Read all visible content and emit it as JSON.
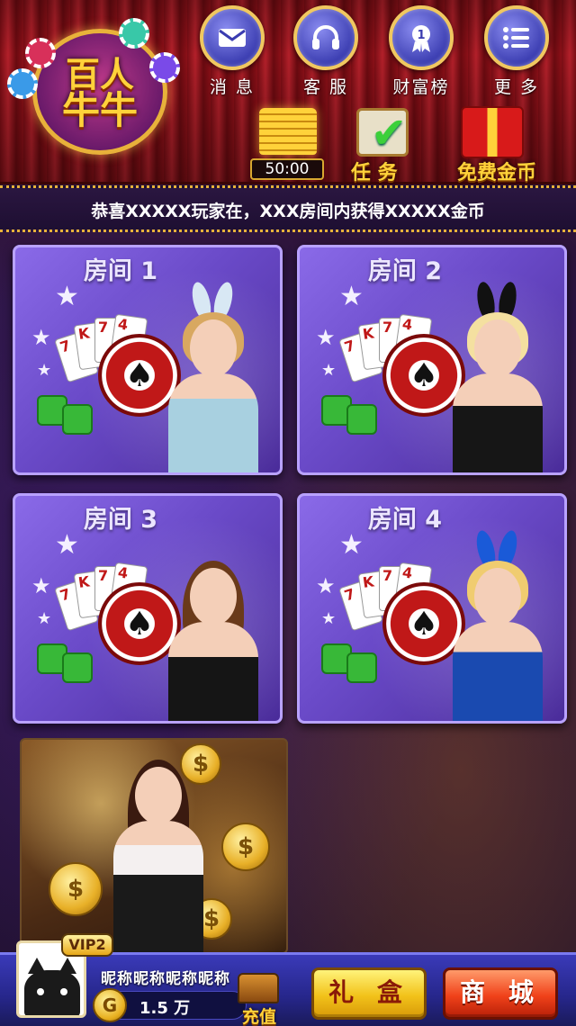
{
  "logo": {
    "line1": "百人",
    "line2": "牛牛"
  },
  "nav": [
    {
      "label": "消 息",
      "icon": "mail-icon"
    },
    {
      "label": "客 服",
      "icon": "headset-icon"
    },
    {
      "label": "财富榜",
      "icon": "medal-icon"
    },
    {
      "label": "更 多",
      "icon": "menu-list-icon"
    }
  ],
  "actions": {
    "timer": "50:00",
    "task_label": "任 务",
    "free_coins_label": "免费金币"
  },
  "marquee": {
    "text": "恭喜XXXXX玩家在，XXX房间内获得XXXXX金币"
  },
  "rooms": [
    {
      "title": "房间 1"
    },
    {
      "title": "房间 2"
    },
    {
      "title": "房间 3"
    },
    {
      "title": "房间 4"
    }
  ],
  "bottom": {
    "vip": "VIP2",
    "nickname": "昵称昵称昵称昵称",
    "gold_amount": "1.5 万",
    "recharge": "充值",
    "gift_button": "礼 盒",
    "shop_button": "商 城"
  },
  "colors": {
    "room_purple": "#6a4ac8",
    "gold": "#ffd23a",
    "curtain_red": "#b3202a",
    "bar_blue": "#3a3ab8"
  }
}
